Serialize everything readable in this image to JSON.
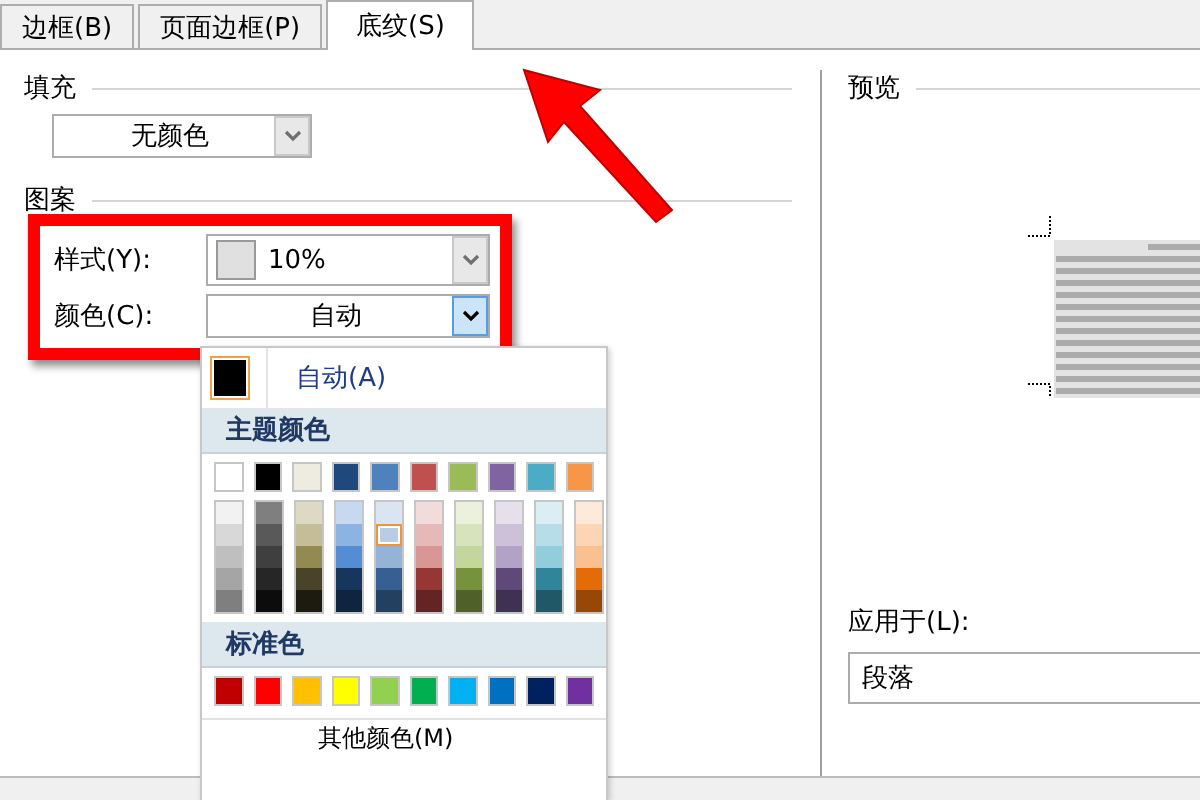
{
  "tabs": [
    {
      "label": "边框(B)",
      "selected": false
    },
    {
      "label": "页面边框(P)",
      "selected": false
    },
    {
      "label": "底纹(S)",
      "selected": true
    }
  ],
  "fill": {
    "heading": "填充",
    "value": "无颜色"
  },
  "pattern": {
    "heading": "图案",
    "style": {
      "label": "样式(Y):",
      "value": "10%"
    },
    "color": {
      "label": "颜色(C):",
      "value": "自动",
      "open": true
    }
  },
  "color_menu": {
    "automatic": {
      "label": "自动(A)",
      "selected": true
    },
    "theme_heading": "主题颜色",
    "theme_colors": [
      {
        "color": "#ffffff",
        "selected": false
      },
      {
        "color": "#000000",
        "selected": false
      },
      {
        "color": "#eeece1",
        "selected": false
      },
      {
        "color": "#1f497d",
        "selected": false
      },
      {
        "color": "#4f81bd",
        "selected": false
      },
      {
        "color": "#c0504d",
        "selected": false
      },
      {
        "color": "#9bbb59",
        "selected": false
      },
      {
        "color": "#8064a2",
        "selected": false
      },
      {
        "color": "#4bacc6",
        "selected": false
      },
      {
        "color": "#f79646",
        "selected": false
      }
    ],
    "theme_shades": [
      {
        "shades": [
          {
            "color": "#f2f2f2",
            "selected": false
          },
          {
            "color": "#d8d8d8",
            "selected": false
          },
          {
            "color": "#bfbfbf",
            "selected": false
          },
          {
            "color": "#a5a5a5",
            "selected": false
          },
          {
            "color": "#7f7f7f",
            "selected": false
          }
        ]
      },
      {
        "shades": [
          {
            "color": "#7f7f7f",
            "selected": false
          },
          {
            "color": "#595959",
            "selected": false
          },
          {
            "color": "#3f3f3f",
            "selected": false
          },
          {
            "color": "#262626",
            "selected": false
          },
          {
            "color": "#0c0c0c",
            "selected": false
          }
        ]
      },
      {
        "shades": [
          {
            "color": "#ddd9c3",
            "selected": false
          },
          {
            "color": "#c4bd97",
            "selected": false
          },
          {
            "color": "#938953",
            "selected": false
          },
          {
            "color": "#494429",
            "selected": false
          },
          {
            "color": "#1d1b10",
            "selected": false
          }
        ]
      },
      {
        "shades": [
          {
            "color": "#c6d9f0",
            "selected": false
          },
          {
            "color": "#8db3e2",
            "selected": false
          },
          {
            "color": "#548dd4",
            "selected": false
          },
          {
            "color": "#17365d",
            "selected": false
          },
          {
            "color": "#0f243e",
            "selected": false
          }
        ]
      },
      {
        "shades": [
          {
            "color": "#dbe5f1",
            "selected": false
          },
          {
            "color": "#b8cce4",
            "selected": true
          },
          {
            "color": "#95b3d7",
            "selected": false
          },
          {
            "color": "#366092",
            "selected": false
          },
          {
            "color": "#244061",
            "selected": false
          }
        ]
      },
      {
        "shades": [
          {
            "color": "#f2dcdb",
            "selected": false
          },
          {
            "color": "#e5b9b7",
            "selected": false
          },
          {
            "color": "#d99694",
            "selected": false
          },
          {
            "color": "#953734",
            "selected": false
          },
          {
            "color": "#632423",
            "selected": false
          }
        ]
      },
      {
        "shades": [
          {
            "color": "#ebf1dd",
            "selected": false
          },
          {
            "color": "#d7e3bc",
            "selected": false
          },
          {
            "color": "#c3d69b",
            "selected": false
          },
          {
            "color": "#76923c",
            "selected": false
          },
          {
            "color": "#4f6128",
            "selected": false
          }
        ]
      },
      {
        "shades": [
          {
            "color": "#e5e0ec",
            "selected": false
          },
          {
            "color": "#ccc1d9",
            "selected": false
          },
          {
            "color": "#b2a2c7",
            "selected": false
          },
          {
            "color": "#5f497a",
            "selected": false
          },
          {
            "color": "#3f3151",
            "selected": false
          }
        ]
      },
      {
        "shades": [
          {
            "color": "#dbeef3",
            "selected": false
          },
          {
            "color": "#b7dde8",
            "selected": false
          },
          {
            "color": "#92cddc",
            "selected": false
          },
          {
            "color": "#31859b",
            "selected": false
          },
          {
            "color": "#205867",
            "selected": false
          }
        ]
      },
      {
        "shades": [
          {
            "color": "#fdeada",
            "selected": false
          },
          {
            "color": "#fbd5b5",
            "selected": false
          },
          {
            "color": "#fac08f",
            "selected": false
          },
          {
            "color": "#e36c09",
            "selected": false
          },
          {
            "color": "#974806",
            "selected": false
          }
        ]
      }
    ],
    "standard_heading": "标准色",
    "standard_colors": [
      {
        "color": "#c00000",
        "selected": false
      },
      {
        "color": "#ff0000",
        "selected": false
      },
      {
        "color": "#ffc000",
        "selected": false
      },
      {
        "color": "#ffff00",
        "selected": false
      },
      {
        "color": "#92d050",
        "selected": false
      },
      {
        "color": "#00b050",
        "selected": false
      },
      {
        "color": "#00b0f0",
        "selected": false
      },
      {
        "color": "#0070c0",
        "selected": false
      },
      {
        "color": "#002060",
        "selected": false
      },
      {
        "color": "#7030a0",
        "selected": false
      }
    ],
    "more": "其他颜色(M)"
  },
  "preview": {
    "heading": "预览"
  },
  "apply_to": {
    "label": "应用于(L):",
    "value": "段落"
  }
}
